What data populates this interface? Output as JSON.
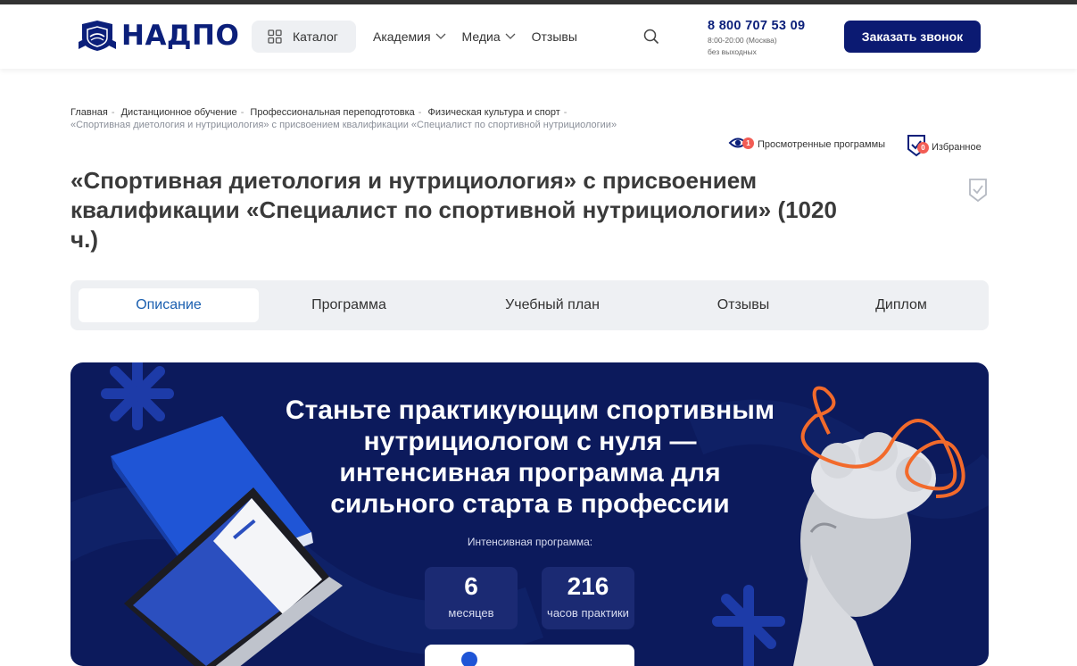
{
  "header": {
    "logo_text": "НАДПО",
    "catalog_label": "Каталог",
    "nav": [
      {
        "label": "Академия",
        "has_dropdown": true
      },
      {
        "label": "Медиа",
        "has_dropdown": true
      },
      {
        "label": "Отзывы",
        "has_dropdown": false
      }
    ],
    "phone": "8 800 707 53 09",
    "phone_hours": "8:00-20:00 (Москва)",
    "phone_days": "без выходных",
    "call_button": "Заказать звонок"
  },
  "breadcrumb": {
    "items": [
      "Главная",
      "Дистанционное обучение",
      "Профессиональная переподготовка",
      "Физическая культура и спорт"
    ],
    "current": "«Спортивная диетология и нутрициология» с присвоением квалификации «Специалист по спортивной нутрициологии»"
  },
  "actions": {
    "viewed_label": "Просмотренные программы",
    "viewed_count": "1",
    "favorites_label": "Избранное",
    "favorites_count": "0"
  },
  "page": {
    "title": "«Спортивная диетология и нутрициология» с присвоением квалификации «Специалист по спортивной нутрициологии» (1020 ч.)"
  },
  "tabs": [
    {
      "label": "Описание",
      "active": true
    },
    {
      "label": "Программа",
      "active": false
    },
    {
      "label": "Учебный план",
      "active": false
    },
    {
      "label": "Отзывы",
      "active": false
    },
    {
      "label": "Диплом",
      "active": false
    }
  ],
  "banner": {
    "headline": "Станьте практикующим спортивным нутрициологом с нуля — интенсивная программа для сильного старта в профессии",
    "subtitle": "Интенсивная программа:",
    "stats": [
      {
        "value": "6",
        "label": "месяцев"
      },
      {
        "value": "216",
        "label": "часов практики"
      }
    ]
  },
  "colors": {
    "brand": "#0b1f7a",
    "banner_bg": "#0c1a5c",
    "accent_orange": "#f26a2b",
    "badge": "#f25c54",
    "active_tab_text": "#1a5fb0"
  }
}
